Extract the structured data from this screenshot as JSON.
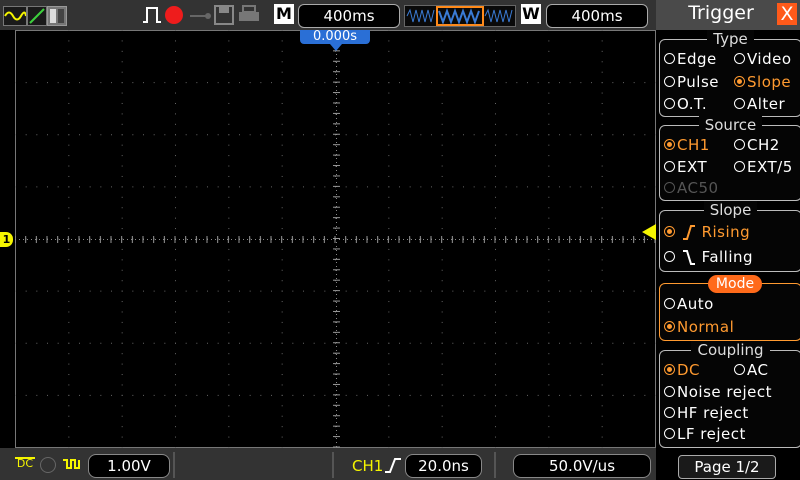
{
  "top_bar": {
    "timebase_label": "M",
    "timebase_value": "400ms",
    "window_label": "W",
    "window_value": "400ms",
    "trigger_position": "0.000s"
  },
  "bottom_bar": {
    "ch1_coupling": "DC",
    "ch1_volt_div": "1.00V",
    "trigger_channel": "CH1",
    "trigger_value": "20.0ns",
    "slope_rate": "50.0V/us"
  },
  "channel_marker": "1",
  "panel": {
    "title": "Trigger",
    "close_symbol": "X",
    "sections": {
      "type": {
        "title": "Type",
        "options": [
          {
            "label": "Edge",
            "selected": false
          },
          {
            "label": "Video",
            "selected": false
          },
          {
            "label": "Pulse",
            "selected": false
          },
          {
            "label": "Slope",
            "selected": true
          },
          {
            "label": "O.T.",
            "selected": false
          },
          {
            "label": "Alter",
            "selected": false
          }
        ]
      },
      "source": {
        "title": "Source",
        "options": [
          {
            "label": "CH1",
            "selected": true
          },
          {
            "label": "CH2",
            "selected": false
          },
          {
            "label": "EXT",
            "selected": false
          },
          {
            "label": "EXT/5",
            "selected": false
          },
          {
            "label": "AC50",
            "selected": false,
            "disabled": true
          }
        ]
      },
      "slope": {
        "title": "Slope",
        "options": [
          {
            "label": "Rising",
            "selected": true
          },
          {
            "label": "Falling",
            "selected": false
          }
        ]
      },
      "mode": {
        "title": "Mode",
        "options": [
          {
            "label": "Auto",
            "selected": false
          },
          {
            "label": "Normal",
            "selected": true
          }
        ]
      },
      "coupling": {
        "title": "Coupling",
        "options": [
          {
            "label": "DC",
            "selected": true
          },
          {
            "label": "AC",
            "selected": false
          },
          {
            "label": "Noise reject",
            "selected": false
          },
          {
            "label": "HF reject",
            "selected": false
          },
          {
            "label": "LF reject",
            "selected": false
          }
        ]
      }
    },
    "page_button": "Page 1/2"
  },
  "colors": {
    "accent": "#ff9a30",
    "trigger_marker": "#f5f500",
    "position_flag": "#2a6fd6",
    "grid": "#666666",
    "close": "#ff5a1a"
  }
}
